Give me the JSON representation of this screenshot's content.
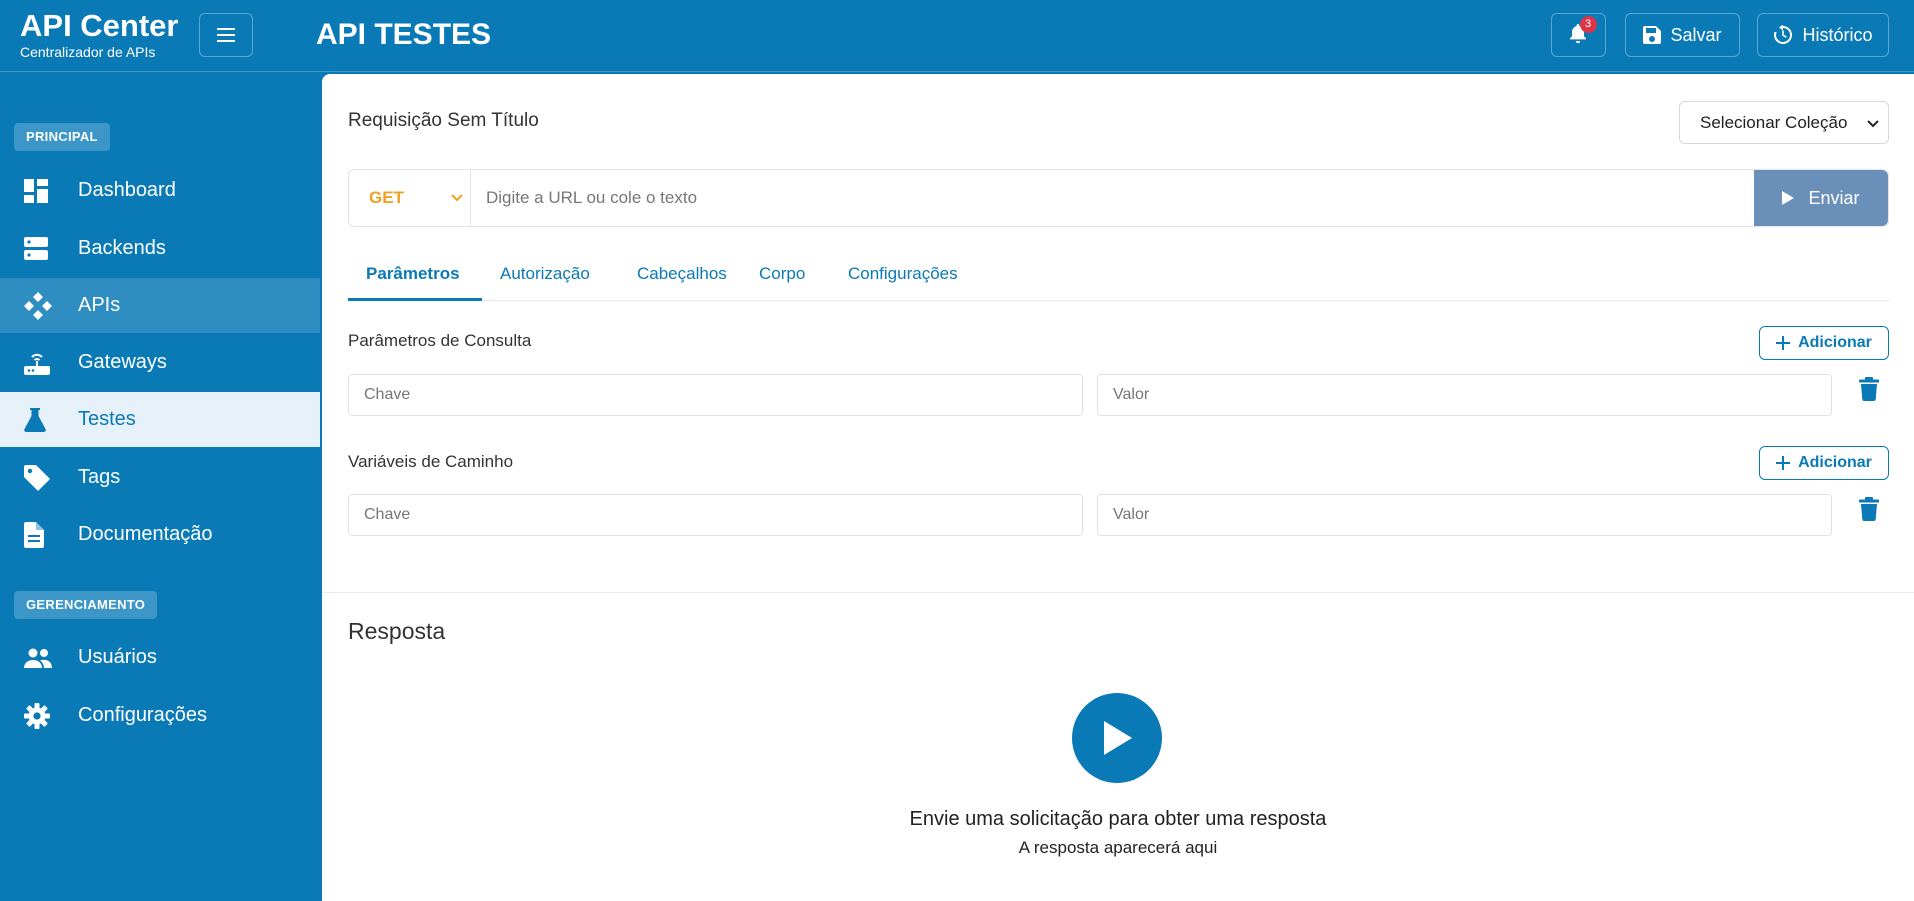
{
  "brand": {
    "title": "API Center",
    "subtitle": "Centralizador de APIs"
  },
  "header": {
    "page_title": "API TESTES",
    "notifications_count": "3",
    "save_label": "Salvar",
    "history_label": "Histórico"
  },
  "sidebar": {
    "section_main": "PRINCIPAL",
    "section_manage": "GERENCIAMENTO",
    "items": [
      {
        "label": "Dashboard",
        "icon": "dashboard-icon"
      },
      {
        "label": "Backends",
        "icon": "server-icon"
      },
      {
        "label": "APIs",
        "icon": "api-icon",
        "state": "hover"
      },
      {
        "label": "Gateways",
        "icon": "router-icon"
      },
      {
        "label": "Testes",
        "icon": "flask-icon",
        "state": "active"
      },
      {
        "label": "Tags",
        "icon": "tag-icon"
      },
      {
        "label": "Documentação",
        "icon": "document-icon"
      },
      {
        "label": "Usuários",
        "icon": "users-icon"
      },
      {
        "label": "Configurações",
        "icon": "gear-icon"
      }
    ]
  },
  "request": {
    "title": "Requisição Sem Título",
    "collection_select": "Selecionar Coleção",
    "method": "GET",
    "url_placeholder": "Digite a URL ou cole o texto",
    "send_label": "Enviar"
  },
  "tabs": [
    "Parâmetros",
    "Autorização",
    "Cabeçalhos",
    "Corpo",
    "Configurações"
  ],
  "query_params": {
    "label": "Parâmetros de Consulta",
    "add_label": "Adicionar",
    "key_placeholder": "Chave",
    "value_placeholder": "Valor"
  },
  "path_vars": {
    "label": "Variáveis de Caminho",
    "add_label": "Adicionar",
    "key_placeholder": "Chave",
    "value_placeholder": "Valor"
  },
  "response": {
    "title": "Resposta",
    "message": "Envie uma solicitação para obter uma resposta",
    "hint": "A resposta aparecerá aqui"
  },
  "colors": {
    "primary": "#0a7ab7",
    "send_button": "#6a8fb8",
    "method_get": "#f0a020",
    "badge": "#dc3545"
  }
}
